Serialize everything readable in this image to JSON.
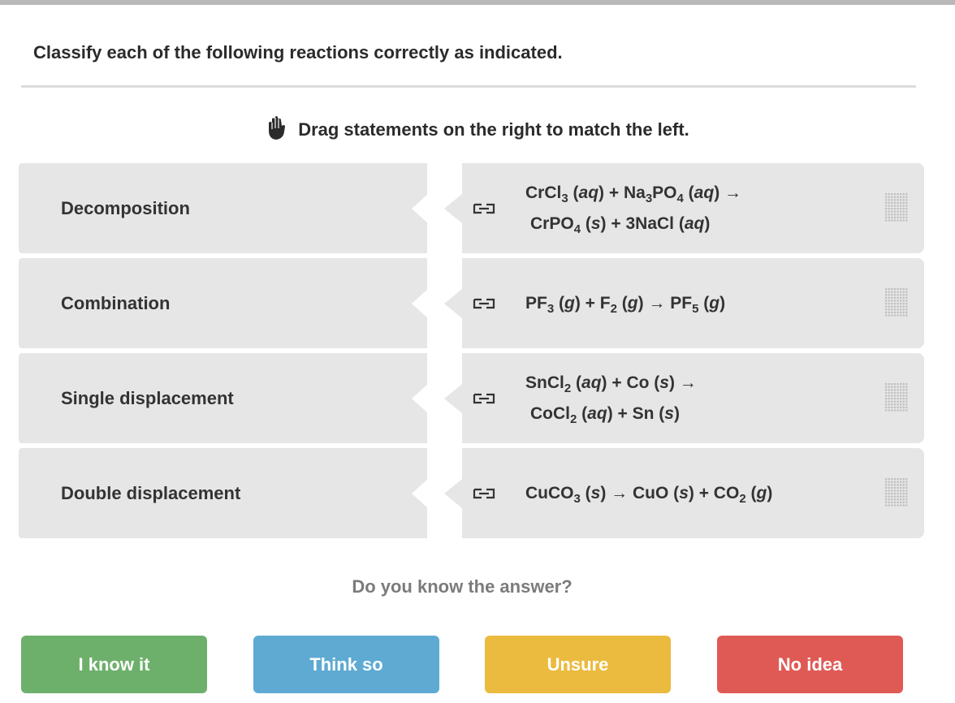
{
  "question": "Classify each of the following reactions correctly as indicated.",
  "instruction": {
    "icon": "hand-icon",
    "text": "Drag statements on the right to match the left."
  },
  "rows": [
    {
      "category": "Decomposition",
      "formula_lines": [
        [
          [
            "t",
            "CrCl"
          ],
          [
            "s",
            "3"
          ],
          [
            "t",
            " ("
          ],
          [
            "i",
            "aq"
          ],
          [
            "t",
            ") + Na"
          ],
          [
            "s",
            "3"
          ],
          [
            "t",
            "PO"
          ],
          [
            "s",
            "4"
          ],
          [
            "t",
            " ("
          ],
          [
            "i",
            "aq"
          ],
          [
            "t",
            ") →"
          ]
        ],
        [
          [
            "t",
            "CrPO"
          ],
          [
            "s",
            "4"
          ],
          [
            "t",
            " ("
          ],
          [
            "i",
            "s"
          ],
          [
            "t",
            ") + 3NaCl ("
          ],
          [
            "i",
            "aq"
          ],
          [
            "t",
            ")"
          ]
        ]
      ]
    },
    {
      "category": "Combination",
      "formula_lines": [
        [
          [
            "t",
            "PF"
          ],
          [
            "s",
            "3"
          ],
          [
            "t",
            " ("
          ],
          [
            "i",
            "g"
          ],
          [
            "t",
            ") + F"
          ],
          [
            "s",
            "2"
          ],
          [
            "t",
            " ("
          ],
          [
            "i",
            "g"
          ],
          [
            "t",
            ") → PF"
          ],
          [
            "s",
            "5"
          ],
          [
            "t",
            " ("
          ],
          [
            "i",
            "g"
          ],
          [
            "t",
            ")"
          ]
        ]
      ]
    },
    {
      "category": "Single displacement",
      "formula_lines": [
        [
          [
            "t",
            "SnCl"
          ],
          [
            "s",
            "2"
          ],
          [
            "t",
            " ("
          ],
          [
            "i",
            "aq"
          ],
          [
            "t",
            ") + Co ("
          ],
          [
            "i",
            "s"
          ],
          [
            "t",
            ") →"
          ]
        ],
        [
          [
            "t",
            "CoCl"
          ],
          [
            "s",
            "2"
          ],
          [
            "t",
            " ("
          ],
          [
            "i",
            "aq"
          ],
          [
            "t",
            ") + Sn ("
          ],
          [
            "i",
            "s"
          ],
          [
            "t",
            ")"
          ]
        ]
      ]
    },
    {
      "category": "Double displacement",
      "formula_lines": [
        [
          [
            "t",
            "CuCO"
          ],
          [
            "s",
            "3"
          ],
          [
            "t",
            " ("
          ],
          [
            "i",
            "s"
          ],
          [
            "t",
            ") → CuO ("
          ],
          [
            "i",
            "s"
          ],
          [
            "t",
            ") + CO"
          ],
          [
            "s",
            "2"
          ],
          [
            "t",
            " ("
          ],
          [
            "i",
            "g"
          ],
          [
            "t",
            ")"
          ]
        ]
      ]
    }
  ],
  "confidence_prompt": "Do you know the answer?",
  "buttons": {
    "know": "I know it",
    "think": "Think so",
    "unsure": "Unsure",
    "no_idea": "No idea"
  },
  "colors": {
    "know": "#6db06b",
    "think": "#5eaad3",
    "unsure": "#ebbb3f",
    "no_idea": "#e05a55",
    "box": "#e6e6e6"
  }
}
